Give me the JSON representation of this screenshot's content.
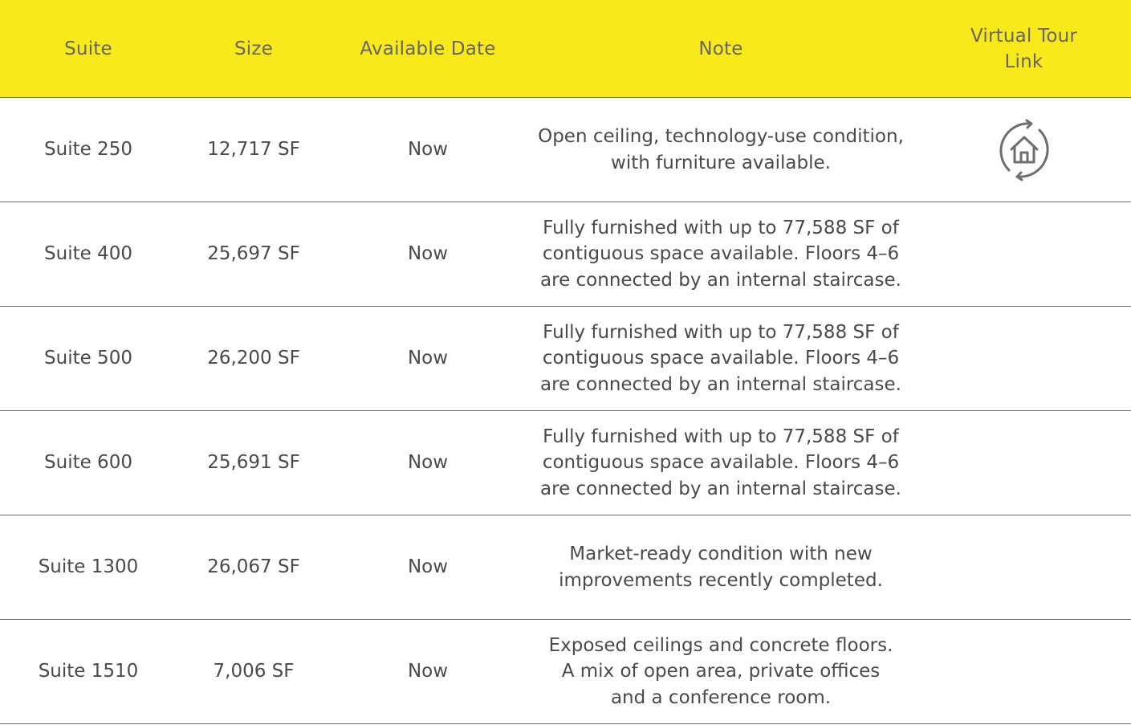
{
  "header": {
    "suite": "Suite",
    "size": "Size",
    "available_date": "Available Date",
    "note": "Note",
    "virtual_tour": "Virtual Tour\nLink"
  },
  "rows": [
    {
      "suite": "Suite 250",
      "size": "12,717 SF",
      "available": "Now",
      "note": "Open ceiling, technology-use condition,\nwith furniture available.",
      "tour_icon": "virtual-tour-home-icon"
    },
    {
      "suite": "Suite 400",
      "size": "25,697 SF",
      "available": "Now",
      "note": "Fully furnished with up to 77,588 SF of\ncontiguous space available. Floors 4–6\nare connected by an internal staircase."
    },
    {
      "suite": "Suite 500",
      "size": "26,200 SF",
      "available": "Now",
      "note": "Fully furnished with up to 77,588 SF of\ncontiguous space available. Floors 4–6\nare connected by an internal staircase."
    },
    {
      "suite": "Suite 600",
      "size": "25,691 SF",
      "available": "Now",
      "note": "Fully furnished with up to 77,588 SF of\ncontiguous space available. Floors 4–6\nare connected by an internal staircase."
    },
    {
      "suite": "Suite 1300",
      "size": "26,067 SF",
      "available": "Now",
      "note": "Market-ready condition with new\nimprovements recently completed."
    },
    {
      "suite": "Suite 1510",
      "size": "7,006 SF",
      "available": "Now",
      "note": "Exposed ceilings and concrete floors.\nA mix of open area, private offices\nand a conference room."
    }
  ],
  "colors": {
    "header_bg": "#f7e91a",
    "text": "#4a4a4a",
    "divider": "#6b6b6b",
    "icon": "#6e6e6e"
  }
}
